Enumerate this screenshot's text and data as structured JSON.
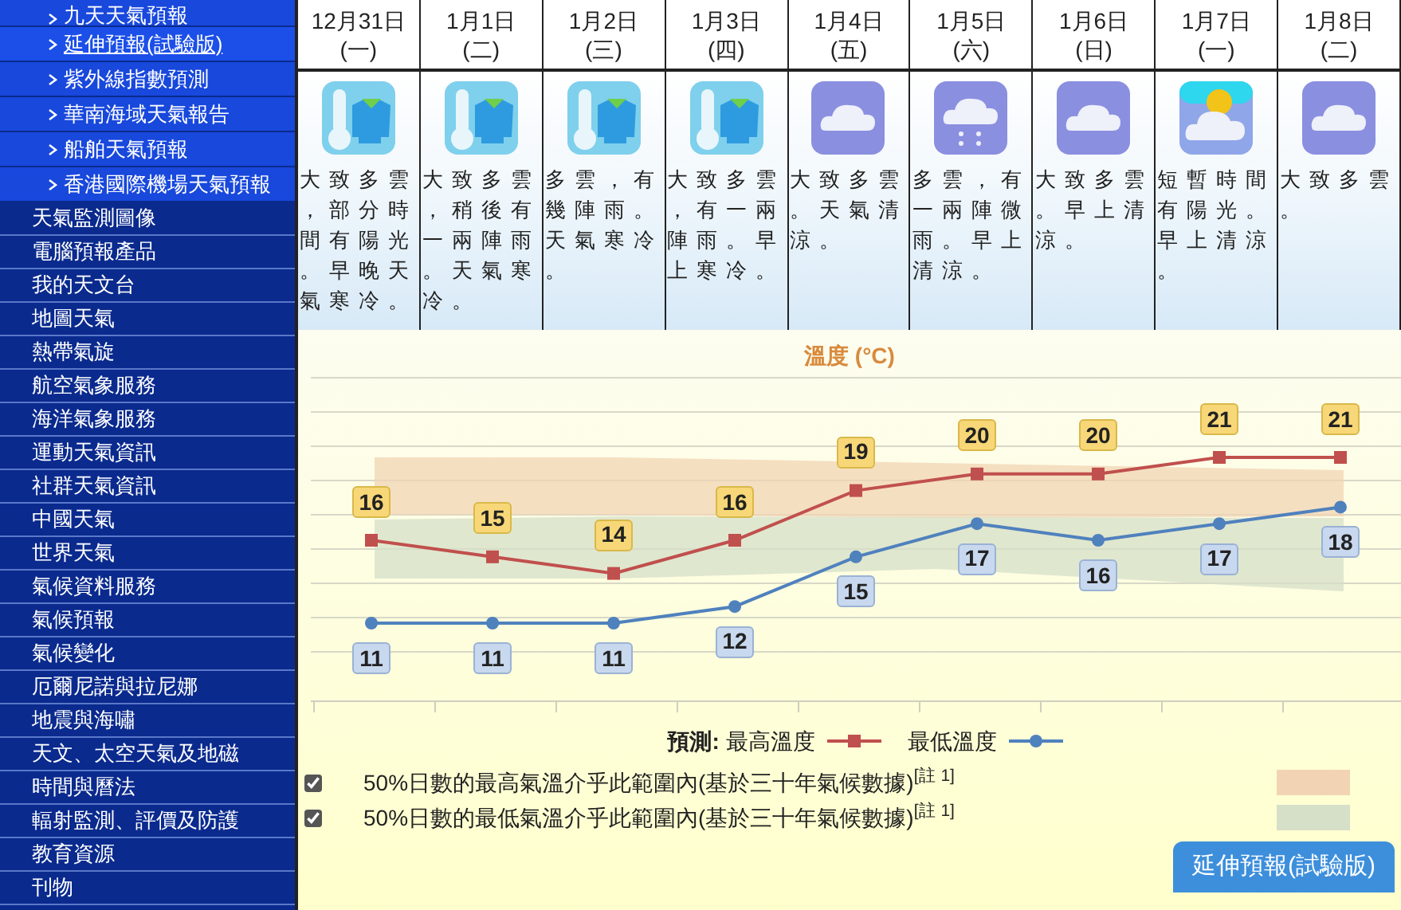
{
  "sidebar": {
    "sub_items": [
      {
        "label": "九天天氣預報",
        "selected": false
      },
      {
        "label": "延伸預報(試驗版)",
        "selected": true
      },
      {
        "label": "紫外線指數預測",
        "selected": false
      },
      {
        "label": "華南海域天氣報告",
        "selected": false
      },
      {
        "label": "船舶天氣預報",
        "selected": false
      },
      {
        "label": "香港國際機場天氣預報",
        "selected": false
      }
    ],
    "items": [
      "天氣監測圖像",
      "電腦預報產品",
      "我的天文台",
      "地圖天氣",
      "熱帶氣旋",
      "航空氣象服務",
      "海洋氣象服務",
      "運動天氣資訊",
      "社群天氣資訊",
      "中國天氣",
      "世界天氣",
      "氣候資料服務",
      "氣候預報",
      "氣候變化",
      "厄爾尼諾與拉尼娜",
      "地震與海嘯",
      "天文、太空天氣及地磁",
      "時間與曆法",
      "輻射監測、評價及防護",
      "教育資源",
      "刊物"
    ]
  },
  "days": [
    {
      "date": "12月31日",
      "weekday": "(一)",
      "kind": "cold",
      "text": "大致多雲，部分時間有陽光。早晚天氣寒冷。"
    },
    {
      "date": "1月1日",
      "weekday": "(二)",
      "kind": "cold",
      "text": "大致多雲，稍後有一兩陣雨。天氣寒冷。"
    },
    {
      "date": "1月2日",
      "weekday": "(三)",
      "kind": "cold",
      "text": "多雲，有幾陣雨。天氣寒冷。"
    },
    {
      "date": "1月3日",
      "weekday": "(四)",
      "kind": "cold",
      "text": "大致多雲，有一兩陣雨。早上寒冷。"
    },
    {
      "date": "1月4日",
      "weekday": "(五)",
      "kind": "cloudy",
      "text": "大致多雲。天氣清涼。"
    },
    {
      "date": "1月5日",
      "weekday": "(六)",
      "kind": "rain",
      "text": "多雲，有一兩陣微雨。早上清涼。"
    },
    {
      "date": "1月6日",
      "weekday": "(日)",
      "kind": "cloudy",
      "text": "大致多雲。早上清涼。"
    },
    {
      "date": "1月7日",
      "weekday": "(一)",
      "kind": "sun_cloud",
      "text": "短暫時間有陽光。早上清涼。"
    },
    {
      "date": "1月8日",
      "weekday": "(二)",
      "kind": "cloudy",
      "text": "大致多雲。"
    }
  ],
  "chart": {
    "chart_data": {
      "type": "line",
      "title": "溫度 (°C)",
      "data_labels": true,
      "series": [
        {
          "name": "最高溫度",
          "color": "#c0504d",
          "marker": "square",
          "values": [
            16,
            15,
            14,
            16,
            19,
            20,
            20,
            21,
            21
          ]
        },
        {
          "name": "最低溫度",
          "color": "#4f81bd",
          "marker": "circle",
          "values": [
            11,
            11,
            11,
            12,
            15,
            17,
            16,
            17,
            18
          ]
        }
      ]
    },
    "legend_prefix": "預測:",
    "ranges": [
      {
        "label": "50%日數的最高氣溫介乎此範圍內(基於三十年氣候數據)$^{[註 1]}$",
        "checked": true,
        "color": "#f2d4b4"
      },
      {
        "label": "50%日數的最低氣溫介乎此範圍內(基於三十年氣候數據)$^{[註 1]}$",
        "checked": true,
        "color": "#d6dfc8"
      }
    ]
  },
  "extended_button": "延伸預報(試驗版)"
}
